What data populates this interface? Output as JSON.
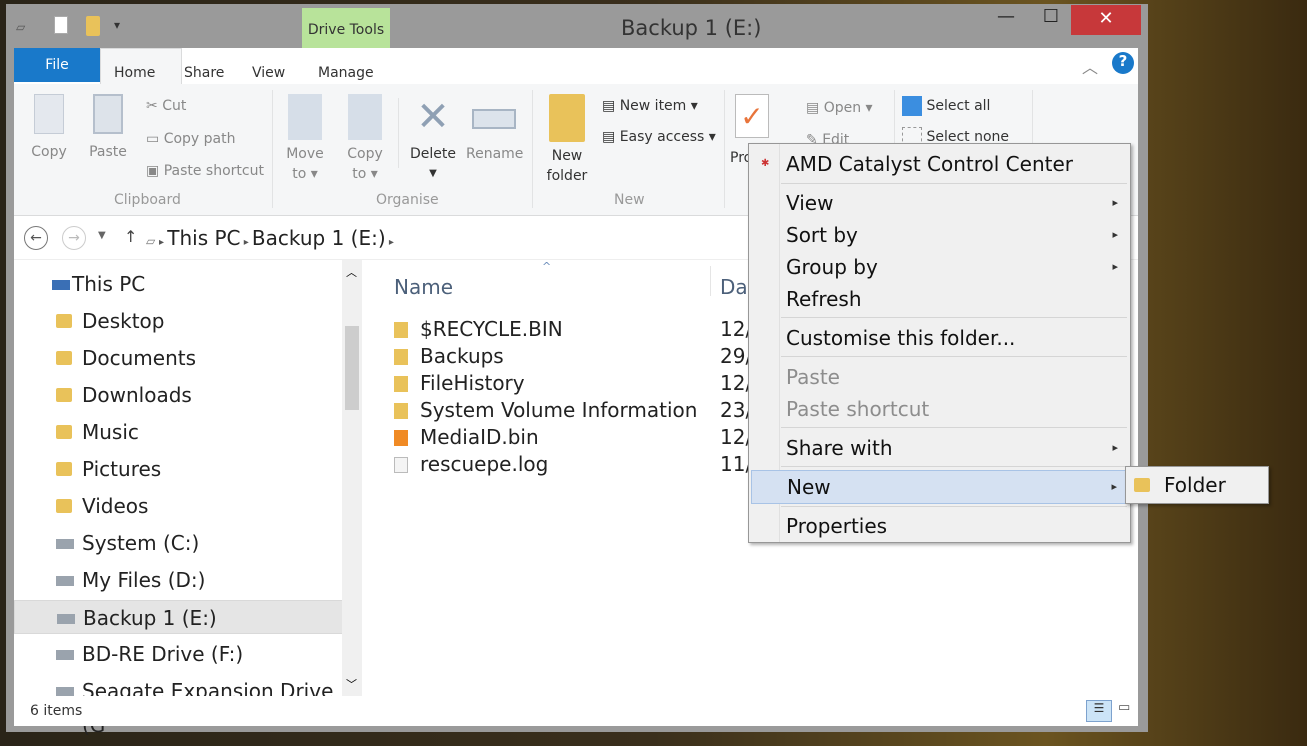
{
  "window": {
    "title": "Backup 1 (E:)",
    "contextual_tab_group": "Drive Tools",
    "minimize": "—",
    "maximize": "☐",
    "close": "✕"
  },
  "ribbon_tabs": [
    "File",
    "Home",
    "Share",
    "View",
    "Manage"
  ],
  "ribbon": {
    "clipboard": {
      "label": "Clipboard",
      "copy": "Copy",
      "paste": "Paste",
      "cut": "Cut",
      "copy_path": "Copy path",
      "paste_shortcut": "Paste shortcut"
    },
    "organise": {
      "label": "Organise",
      "move_to": [
        "Move",
        "to ▾"
      ],
      "copy_to": [
        "Copy",
        "to ▾"
      ],
      "delete": "Delete",
      "rename": "Rename"
    },
    "new": {
      "label": "New",
      "new_folder": [
        "New",
        "folder"
      ],
      "new_item": "New item ▾",
      "easy_access": "Easy access ▾"
    },
    "open": {
      "properties": "Pro",
      "open": "Open ▾",
      "edit": "Edit"
    },
    "select": {
      "select_all": "Select all",
      "select_none": "Select none"
    }
  },
  "address": {
    "crumbs": [
      "This PC",
      "Backup 1 (E:)"
    ]
  },
  "nav": {
    "items": [
      {
        "label": "This PC",
        "icon": "pc-icon"
      },
      {
        "label": "Desktop",
        "icon": "folder-icon"
      },
      {
        "label": "Documents",
        "icon": "folder-icon"
      },
      {
        "label": "Downloads",
        "icon": "folder-icon"
      },
      {
        "label": "Music",
        "icon": "folder-icon"
      },
      {
        "label": "Pictures",
        "icon": "folder-icon"
      },
      {
        "label": "Videos",
        "icon": "folder-icon"
      },
      {
        "label": "System (C:)",
        "icon": "drive-icon"
      },
      {
        "label": "My Files (D:)",
        "icon": "drive-icon"
      },
      {
        "label": "Backup 1 (E:)",
        "icon": "drive-icon",
        "selected": true
      },
      {
        "label": "BD-RE Drive (F:)",
        "icon": "disc-drive-icon"
      },
      {
        "label": "Seagate Expansion Drive (G",
        "icon": "drive-icon"
      }
    ]
  },
  "columns": {
    "name": "Name",
    "date": "Dat"
  },
  "files": [
    {
      "name": "$RECYCLE.BIN",
      "date": "12/",
      "icon": "folder-icon"
    },
    {
      "name": "Backups",
      "date": "29/",
      "icon": "folder-icon"
    },
    {
      "name": "FileHistory",
      "date": "12/",
      "icon": "folder-icon"
    },
    {
      "name": "System Volume Information",
      "date": "23/",
      "icon": "folder-icon"
    },
    {
      "name": "MediaID.bin",
      "date": "12/",
      "icon": "vlc-icon"
    },
    {
      "name": "rescuepe.log",
      "date": "11/",
      "icon": "text-file-icon"
    }
  ],
  "status": {
    "count": "6 items"
  },
  "context_menu": {
    "amd": "AMD Catalyst Control Center",
    "view": "View",
    "sort_by": "Sort by",
    "group_by": "Group by",
    "refresh": "Refresh",
    "customise": "Customise this folder...",
    "paste": "Paste",
    "paste_shortcut": "Paste shortcut",
    "share_with": "Share with",
    "new": "New",
    "properties": "Properties"
  },
  "submenu": {
    "folder": "Folder"
  }
}
